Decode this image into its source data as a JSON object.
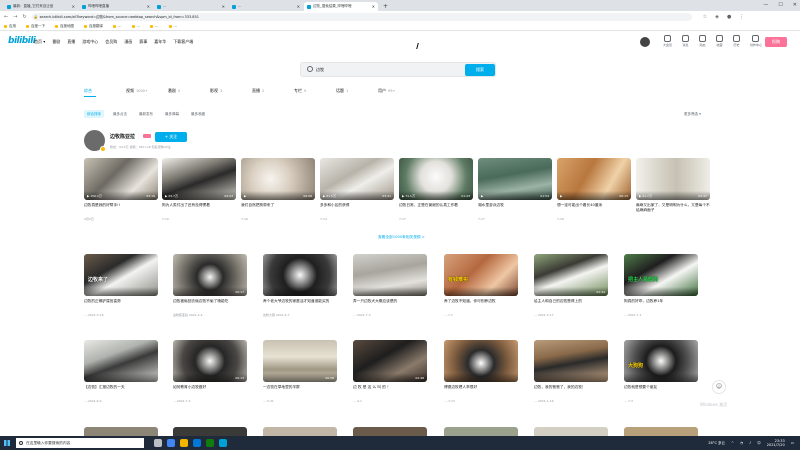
{
  "browser": {
    "tabs": [
      {
        "label": "最新：直播_它们来自迁徙",
        "active": false
      },
      {
        "label": "哔哩哔哩直播",
        "active": false
      },
      {
        "label": "…",
        "active": false
      },
      {
        "label": "…",
        "active": false
      },
      {
        "label": "边牧_搜索结果_哔哩哔哩",
        "active": true
      }
    ],
    "new_tab": "+",
    "window_controls": [
      "—",
      "☐",
      "✕"
    ],
    "url": "search.bilibili.com/all?keyword=边牧&from_source=webtop_search&spm_id_from=333.851",
    "bookmarks": [
      "应用",
      "百度一下",
      "百度地图",
      "百度翻译",
      "…",
      "…",
      "…",
      "…"
    ]
  },
  "header": {
    "logo": "bilibili",
    "left_nav": [
      "首页 ▾",
      "番剧",
      "直播",
      "游戏中心",
      "会员购",
      "漫画",
      "赛事",
      "嘉年华",
      "下载客户端"
    ],
    "right_nav": [
      "大会员",
      "消息",
      "动态",
      "收藏",
      "历史",
      "创作中心"
    ],
    "upload_label": "投稿"
  },
  "search": {
    "query": "边牧",
    "button_label": "搜索"
  },
  "category_tabs": [
    {
      "label": "综合",
      "count": ""
    },
    {
      "label": "视频",
      "count": "1000+"
    },
    {
      "label": "番剧",
      "count": "0"
    },
    {
      "label": "影视",
      "count": "3"
    },
    {
      "label": "直播",
      "count": "2"
    },
    {
      "label": "专栏",
      "count": "9"
    },
    {
      "label": "话题",
      "count": "1"
    },
    {
      "label": "用户",
      "count": "99+"
    }
  ],
  "filters": [
    "综合排序",
    "最多点击",
    "最新发布",
    "最多弹幕",
    "最多收藏"
  ],
  "more_filters": "更多筛选 ▾",
  "up_card": {
    "name": "边牧陈亚拉",
    "follow_label": "+ 关注",
    "meta": "粉丝：94.5万  视频：340  Lv6 知名宠物UP主"
  },
  "up_videos": [
    {
      "title": "边牧真是我的好帮手!!",
      "meta": "4月3日",
      "plays": "150.1万",
      "dur": "03:19"
    },
    {
      "title": "狗为人类付出了还有没得惯着",
      "meta": "7-10",
      "plays": "23.7万",
      "dur": "02:23"
    },
    {
      "title": "我们自然把狗带来了",
      "meta": "7-16",
      "plays": "",
      "dur": "00:08"
    },
    {
      "title": "多多和小区的获得",
      "meta": "7-14",
      "plays": "61.5万",
      "dur": "03:41"
    },
    {
      "title": "边牧日常，正是在谢谢的认真工作着",
      "meta": "7-17",
      "plays": "71.1万",
      "dur": "01:43"
    },
    {
      "title": "湖水里游泳边牧",
      "meta": "7-17",
      "plays": "",
      "dur": "01:54"
    },
    {
      "title": "想一定可能出个看长40厘米",
      "meta": "7-16",
      "plays": "",
      "dur": "00:13"
    },
    {
      "title": "麻麻又出家了，又是明明为什么，又是每个不给麻麻面子",
      "meta": "",
      "plays": "21.7万",
      "dur": "02:47"
    }
  ],
  "more_videos": "查看全部1000条相关视频 >",
  "row2_videos": [
    {
      "title": "边牧的正确铲屎官姿势",
      "meta": "…·2021-3-16",
      "plays": "",
      "dur": "",
      "caption": "边牧来了"
    },
    {
      "title": "边牧被偷回去偷边牧不偷了哦能吃",
      "meta": "边牧陈亚拉·2021-2-4",
      "plays": "",
      "dur": "00:17",
      "caption": ""
    },
    {
      "title": "养个老大爷边牧的家庭活才知道谁能买的",
      "meta": "边牧大厨·2021-4-7",
      "plays": "",
      "dur": "",
      "caption": ""
    },
    {
      "title": "弄一只边牧犬大概应该是的",
      "meta": "…·2021-7-3",
      "plays": "",
      "dur": "",
      "caption": ""
    },
    {
      "title": "养了边牧不知道，你可别养边牧",
      "meta": "…·7-1",
      "plays": "",
      "dur": "",
      "caption": "有钱难买"
    },
    {
      "title": "给主人和自己的边牧是得上的",
      "meta": "…·2021-3-17",
      "plays": "",
      "dur": "02:44",
      "caption": ""
    },
    {
      "title": "狗真的好乖，边牧养1年",
      "meta": "…·2021-7-1",
      "plays": "",
      "dur": "",
      "caption": "把主人是帮狗"
    },
    {
      "title": "",
      "meta": "",
      "plays": "",
      "dur": "",
      "caption": ""
    }
  ],
  "row3_videos": [
    {
      "title": "【边牧】汇报边牧的一天",
      "meta": "…·2021-6-9",
      "plays": "",
      "dur": "",
      "caption": ""
    },
    {
      "title": "如何教育小边牧做好",
      "meta": "…·2021-7-2",
      "plays": "",
      "dur": "00:13",
      "caption": ""
    },
    {
      "title": "一边牧在草地里的羊群",
      "meta": "…·5-31",
      "plays": "",
      "dur": "00:58",
      "caption": ""
    },
    {
      "title": "边 牧 是 这 么 叫 的 ！",
      "meta": "…·4-1",
      "plays": "",
      "dur": "02:48",
      "caption": ""
    },
    {
      "title": "博德边牧嗯人乖很好",
      "meta": "…·7-13",
      "plays": "",
      "dur": "",
      "caption": ""
    },
    {
      "title": "边牧，我的爸爸了，我的边牧！",
      "meta": "…·2021-1-16",
      "plays": "",
      "dur": "",
      "caption": ""
    },
    {
      "title": "边牧这种狗，比你想象的还要聪明",
      "meta": "…·7-3",
      "plays": "",
      "dur": "",
      "caption": ""
    },
    {
      "title": "边牧就是想要个朋友",
      "meta": "…·7-3",
      "plays": "",
      "dur": "",
      "caption": "大狗狗"
    }
  ],
  "watermark": "Windows 激活",
  "taskbar": {
    "search_placeholder": "在这里输入你要搜索的内容",
    "time": "23:33",
    "date": "2021/7/20",
    "temp": "28°C 多云",
    "lang": "中"
  }
}
